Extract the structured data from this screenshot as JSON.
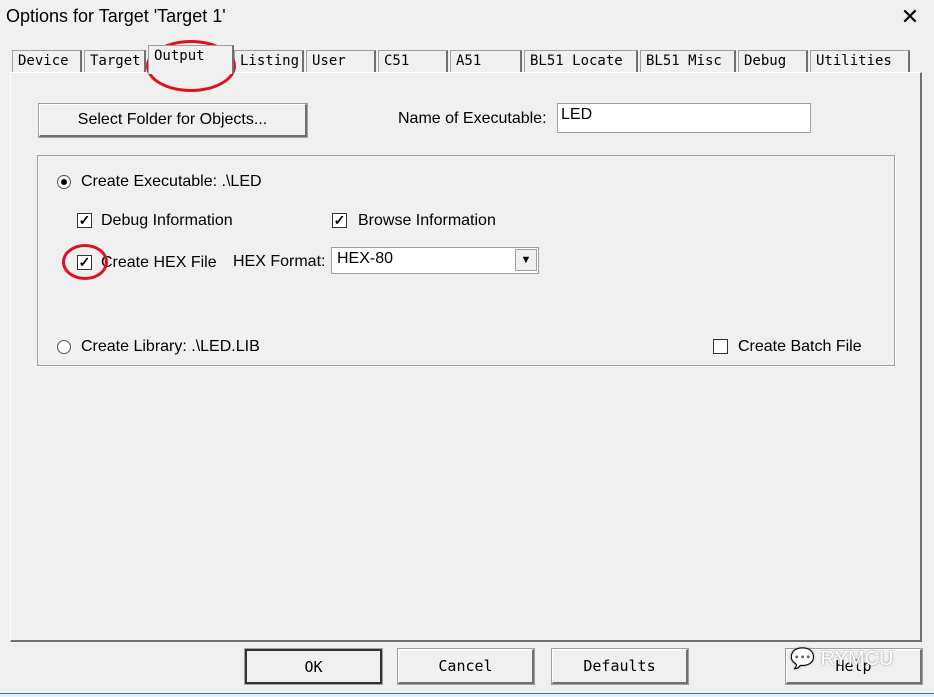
{
  "window": {
    "title": "Options for Target 'Target 1'",
    "close": "✕"
  },
  "tabs": [
    {
      "label": "Device"
    },
    {
      "label": "Target"
    },
    {
      "label": "Output",
      "selected": true
    },
    {
      "label": "Listing"
    },
    {
      "label": "User"
    },
    {
      "label": "C51"
    },
    {
      "label": "A51"
    },
    {
      "label": "BL51 Locate"
    },
    {
      "label": "BL51 Misc"
    },
    {
      "label": "Debug"
    },
    {
      "label": "Utilities"
    }
  ],
  "output": {
    "select_folder_label": "Select Folder for Objects...",
    "name_exec_label": "Name of Executable:",
    "name_exec_value": "LED",
    "create_exec_label": "Create Executable:  .\\LED",
    "create_exec_selected": true,
    "debug_info_label": "Debug Information",
    "debug_info_checked": true,
    "browse_info_label": "Browse Information",
    "browse_info_checked": true,
    "create_hex_label": "Create HEX File",
    "create_hex_checked": true,
    "hex_format_label": "HEX Format:",
    "hex_format_value": "HEX-80",
    "create_lib_label": "Create Library:  .\\LED.LIB",
    "create_lib_selected": false,
    "batch_label": "Create Batch File",
    "batch_checked": false
  },
  "buttons": {
    "ok": "OK",
    "cancel": "Cancel",
    "defaults": "Defaults",
    "help": "Help"
  },
  "watermark": "RYMCU",
  "annotation_color": "#e01020"
}
